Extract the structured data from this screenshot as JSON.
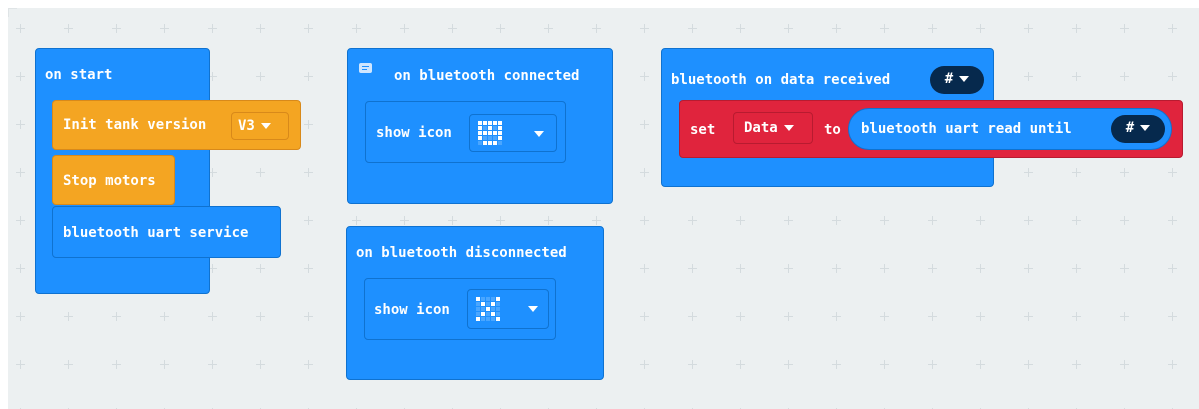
{
  "on_start": {
    "label": "on start",
    "init_tank": {
      "label": "Init tank version",
      "version": "V3"
    },
    "stop_motors": {
      "label": "Stop motors"
    },
    "uart_service": {
      "label": "bluetooth uart service"
    }
  },
  "connected": {
    "label": "on bluetooth connected",
    "comment_icon": "comment-icon",
    "show_icon": {
      "label": "show icon",
      "pattern": [
        [
          1,
          1,
          1,
          1,
          1
        ],
        [
          1,
          0,
          1,
          0,
          1
        ],
        [
          1,
          1,
          1,
          1,
          1
        ],
        [
          1,
          0,
          0,
          0,
          1
        ],
        [
          0,
          1,
          1,
          1,
          0
        ]
      ]
    }
  },
  "disconnected": {
    "label": "on bluetooth disconnected",
    "show_icon": {
      "label": "show icon",
      "pattern": [
        [
          1,
          0,
          0,
          0,
          1
        ],
        [
          0,
          1,
          0,
          1,
          0
        ],
        [
          0,
          0,
          1,
          0,
          0
        ],
        [
          0,
          1,
          0,
          1,
          0
        ],
        [
          1,
          0,
          0,
          0,
          1
        ]
      ]
    }
  },
  "data_received": {
    "label": "bluetooth on data received",
    "delimiter": "#",
    "set": {
      "set_label": "set",
      "variable": "Data",
      "to_label": "to",
      "read_label": "bluetooth uart read until",
      "read_delimiter": "#"
    }
  },
  "colors": {
    "workspace": "#ecf0f1",
    "bluetooth": "#1e90ff",
    "tank": "#f4a522",
    "variables": "#e0243d",
    "delimiter_pill": "#06294d"
  }
}
